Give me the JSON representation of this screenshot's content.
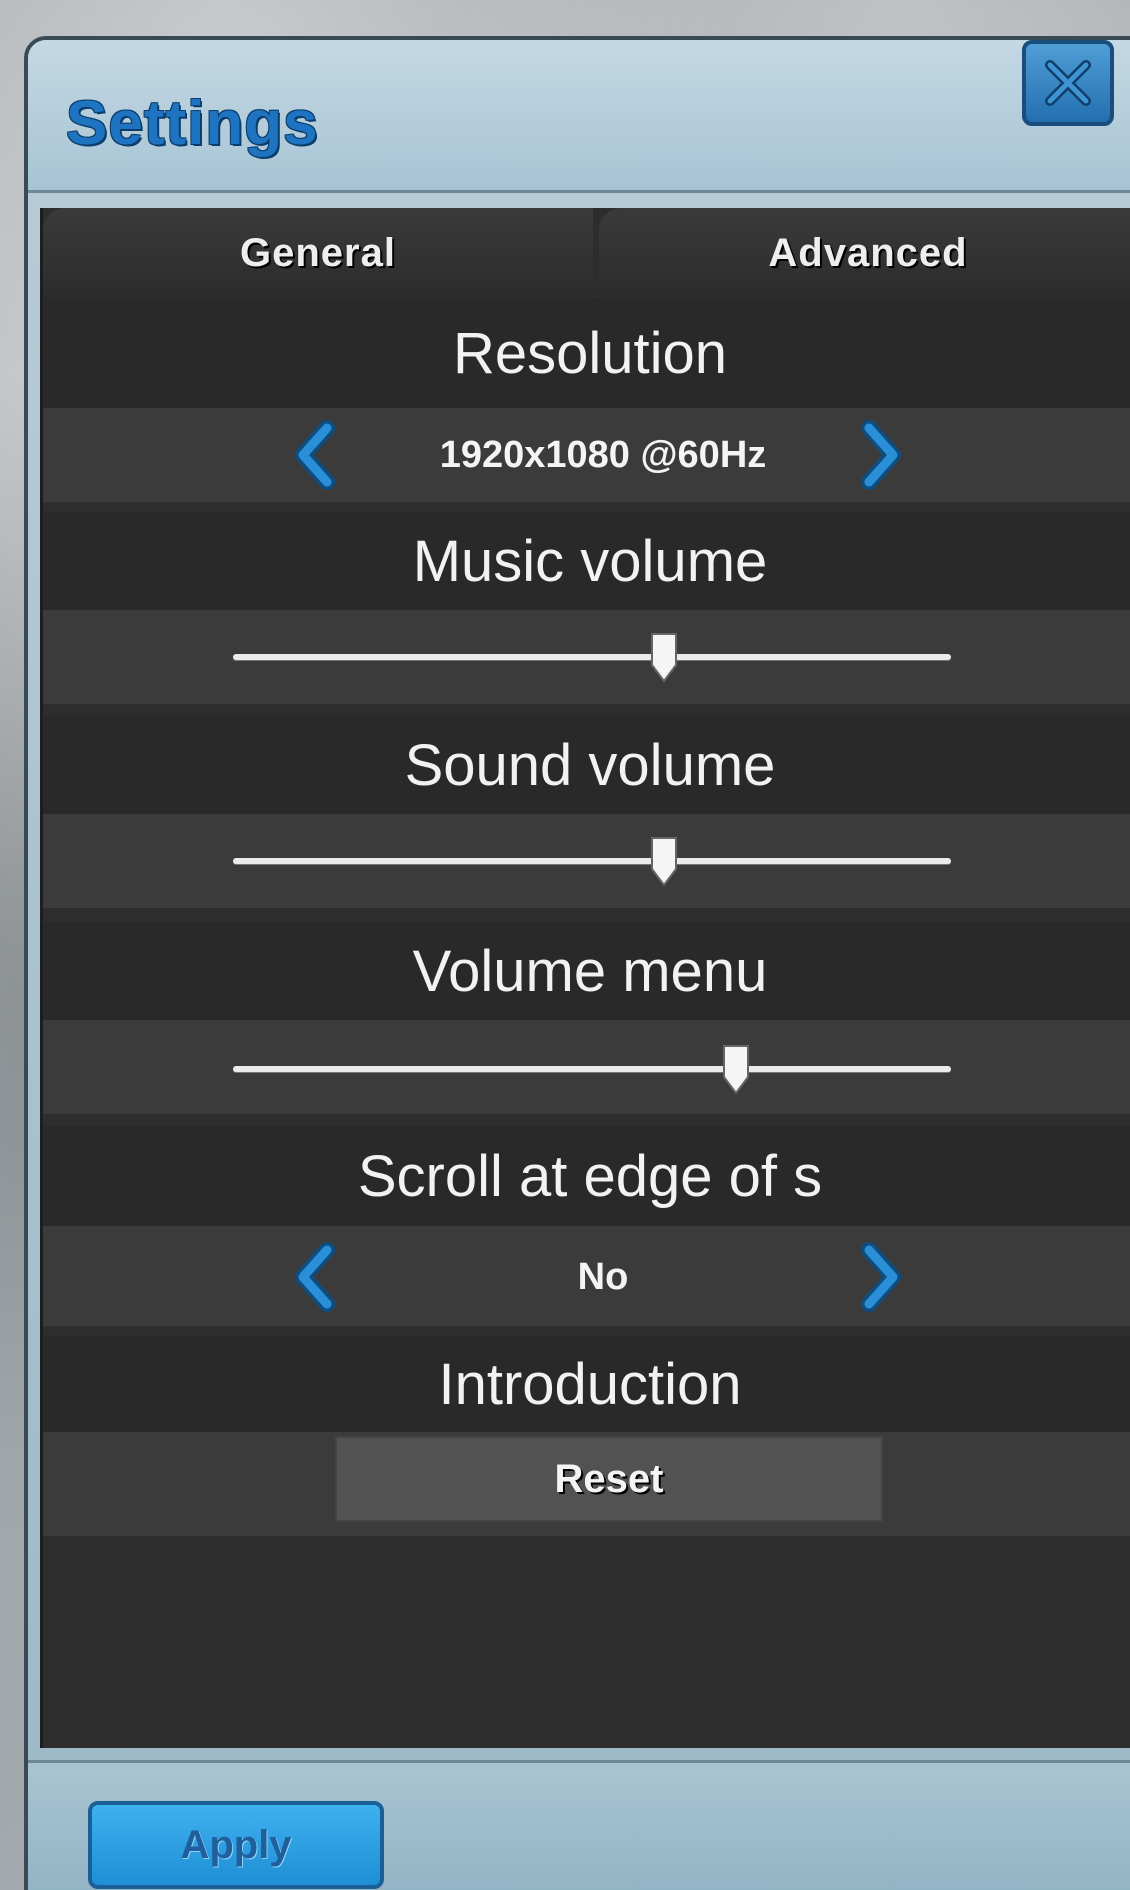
{
  "window": {
    "title": "Settings"
  },
  "tabs": [
    {
      "label": "General"
    },
    {
      "label": "Advanced"
    }
  ],
  "settings": {
    "resolution": {
      "label": "Resolution",
      "value": "1920x1080 @60Hz"
    },
    "music_volume": {
      "label": "Music volume",
      "level": 0.6
    },
    "sound_volume": {
      "label": "Sound volume",
      "level": 0.6
    },
    "volume_menu": {
      "label": "Volume menu",
      "level": 0.7
    },
    "scroll_edge": {
      "label": "Scroll at edge of s",
      "value": "No"
    },
    "introduction": {
      "label": "Introduction",
      "button_label": "Reset"
    }
  },
  "footer": {
    "apply_label": "Apply"
  },
  "colors": {
    "accent": "#1f74c1",
    "arrow": "#2a8fd6",
    "panel": "#2d2d2d"
  }
}
